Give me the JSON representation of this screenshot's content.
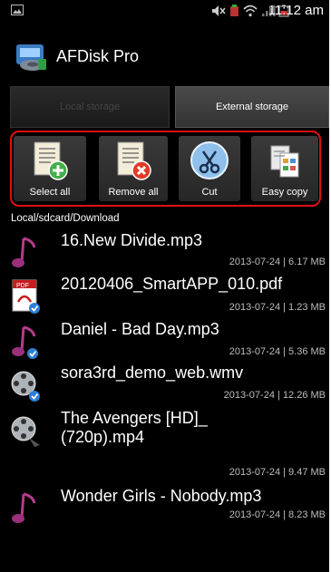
{
  "status_bar": {
    "time": "11:12 am"
  },
  "app": {
    "title": "AFDisk Pro"
  },
  "tabs": [
    {
      "label": "Local storage",
      "selected": false
    },
    {
      "label": "External storage",
      "selected": true
    }
  ],
  "toolbar": {
    "highlight_color": "#e01010",
    "buttons": [
      {
        "label": "Select all",
        "icon": "add-document-icon"
      },
      {
        "label": "Remove all",
        "icon": "remove-document-icon"
      },
      {
        "label": "Cut",
        "icon": "scissors-icon"
      },
      {
        "label": "Easy copy",
        "icon": "copy-documents-icon"
      }
    ]
  },
  "path": "Local/sdcard/Download",
  "files": [
    {
      "name": "16.New Divide.mp3",
      "meta": "2013-07-24 | 6.17 MB",
      "type": "audio"
    },
    {
      "name": "20120406_SmartAPP_010.pdf",
      "meta": "2013-07-24 | 1.23 MB",
      "type": "pdf"
    },
    {
      "name": "Daniel - Bad Day.mp3",
      "meta": "2013-07-24 | 5.36 MB",
      "type": "audio"
    },
    {
      "name": "sora3rd_demo_web.wmv",
      "meta": "2013-07-24 | 12.26 MB",
      "type": "video"
    },
    {
      "name": "The Avengers [HD]_",
      "name2": "(720p).mp4",
      "meta": "2013-07-24 | 9.47 MB",
      "type": "video"
    },
    {
      "name": "Wonder Girls - Nobody.mp3",
      "meta": "2013-07-24 | 8.23 MB",
      "type": "audio"
    }
  ]
}
